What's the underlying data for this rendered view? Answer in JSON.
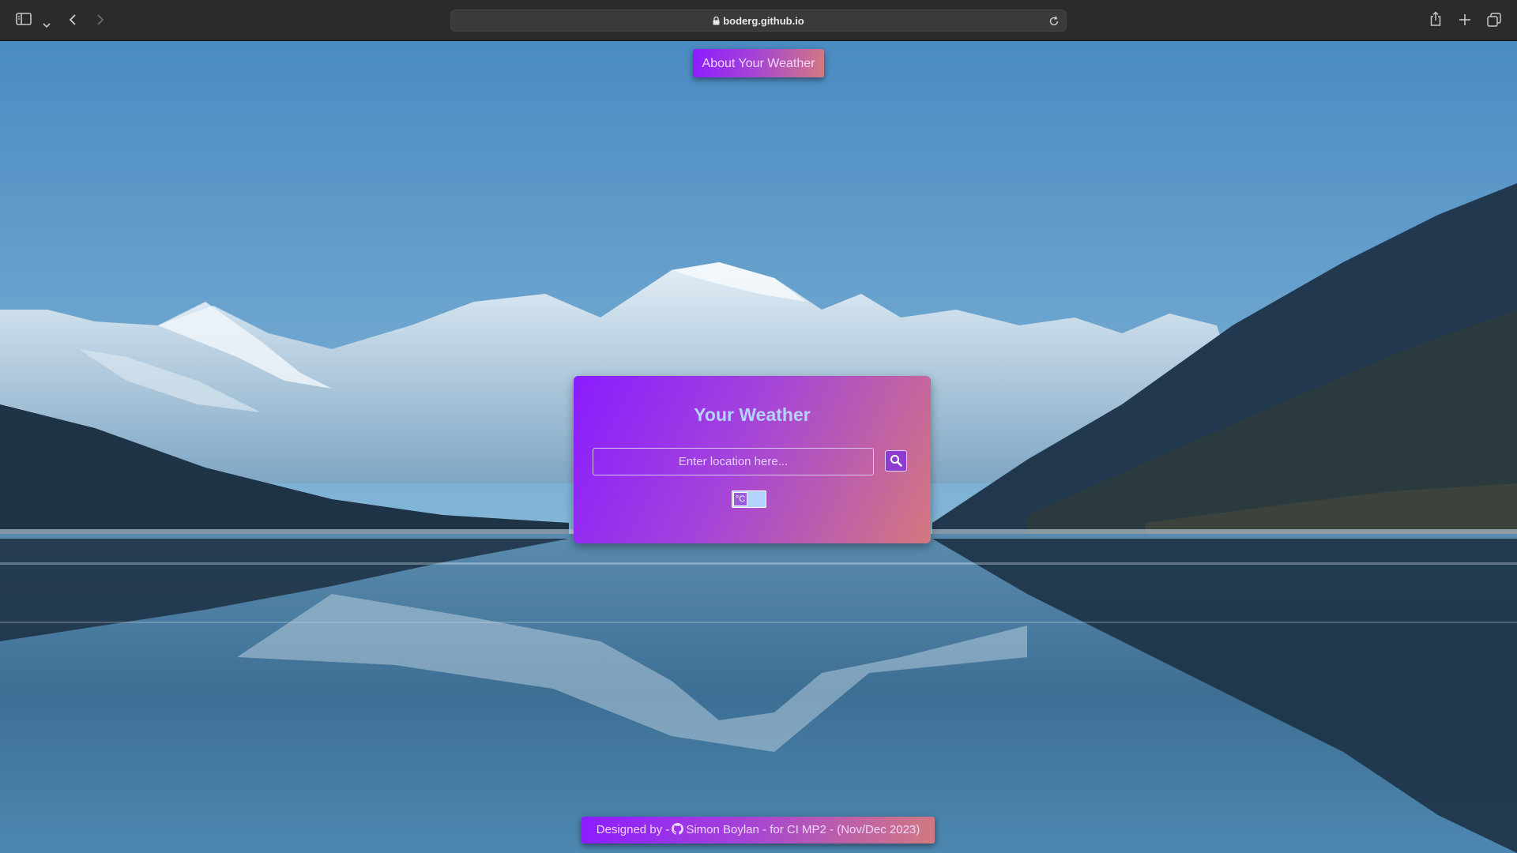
{
  "browser": {
    "url": "boderg.github.io",
    "icons": [
      "sidebar-icon",
      "chevron-down-icon",
      "back-icon",
      "forward-icon",
      "lock-icon",
      "reload-icon",
      "share-icon",
      "new-tab-icon",
      "tabs-overview-icon"
    ]
  },
  "header": {
    "about_label": "About Your Weather"
  },
  "card": {
    "title": "Your Weather",
    "search_placeholder": "Enter location here...",
    "search_icon": "magnifier-icon",
    "unit_toggle_label": "°C"
  },
  "footer": {
    "prefix": "Designed by -",
    "author": "Simon Boylan - for CI MP2 - (Nov/Dec 2023)",
    "icon": "github-icon"
  },
  "colors": {
    "gradient_start": "#8b1dff",
    "gradient_mid": "#a442d8",
    "gradient_end": "#d27a7f",
    "title_color": "#b6d3ff"
  }
}
